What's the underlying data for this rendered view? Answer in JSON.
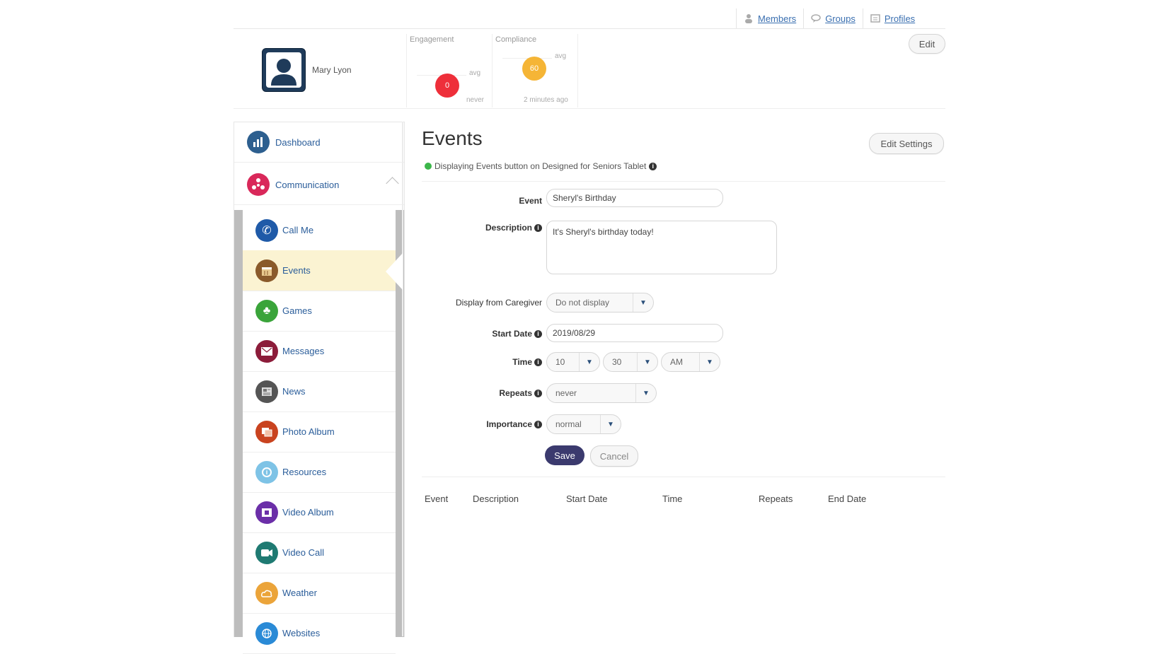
{
  "topnav": {
    "items": [
      {
        "label": "Members",
        "icon": "members-icon"
      },
      {
        "label": "Groups",
        "icon": "groups-icon"
      },
      {
        "label": "Profiles",
        "icon": "profiles-icon"
      }
    ]
  },
  "profile": {
    "name": "Mary Lyon",
    "edit_label": "Edit"
  },
  "gauges": {
    "engagement": {
      "title": "Engagement",
      "avg": "avg",
      "value": "0",
      "footer": "never",
      "color": "#ee2f3a"
    },
    "compliance": {
      "title": "Compliance",
      "avg": "avg",
      "value": "60",
      "footer": "2 minutes ago",
      "color": "#f5b536"
    }
  },
  "sidebar": {
    "dashboard": {
      "label": "Dashboard",
      "icon": "dashboard-icon",
      "color": "#2d5f8f"
    },
    "communication": {
      "label": "Communication",
      "icon": "communication-icon",
      "color": "#d9285a"
    },
    "items": [
      {
        "label": "Call Me",
        "icon": "phone-icon",
        "color": "#1f5aa8"
      },
      {
        "label": "Events",
        "icon": "calendar-icon",
        "color": "#8a5a2b"
      },
      {
        "label": "Games",
        "icon": "club-icon",
        "color": "#3aa43a"
      },
      {
        "label": "Messages",
        "icon": "envelope-icon",
        "color": "#8c1c3a"
      },
      {
        "label": "News",
        "icon": "newspaper-icon",
        "color": "#555555"
      },
      {
        "label": "Photo Album",
        "icon": "photo-icon",
        "color": "#c9431f"
      },
      {
        "label": "Resources",
        "icon": "info-icon",
        "color": "#7ec3e6"
      },
      {
        "label": "Video Album",
        "icon": "video-album-icon",
        "color": "#6b2fa8"
      },
      {
        "label": "Video Call",
        "icon": "video-camera-icon",
        "color": "#1f7a72"
      },
      {
        "label": "Weather",
        "icon": "weather-icon",
        "color": "#eba43a"
      },
      {
        "label": "Websites",
        "icon": "globe-icon",
        "color": "#2a8ad6"
      }
    ]
  },
  "main": {
    "title": "Events",
    "edit_settings_label": "Edit Settings",
    "status_text": "Displaying Events button on Designed for Seniors Tablet",
    "form": {
      "event_label": "Event",
      "event_value": "Sheryl's Birthday",
      "description_label": "Description",
      "description_value": "It's Sheryl's birthday today!",
      "display_from_label": "Display from Caregiver",
      "display_from_value": "Do not display",
      "start_date_label": "Start Date",
      "start_date_value": "2019/08/29",
      "time_label": "Time",
      "time_hour": "10",
      "time_minute": "30",
      "time_ampm": "AM",
      "repeats_label": "Repeats",
      "repeats_value": "never",
      "importance_label": "Importance",
      "importance_value": "normal",
      "save_label": "Save",
      "cancel_label": "Cancel"
    },
    "table_headers": [
      "Event",
      "Description",
      "Start Date",
      "Time",
      "Repeats",
      "End Date"
    ]
  }
}
